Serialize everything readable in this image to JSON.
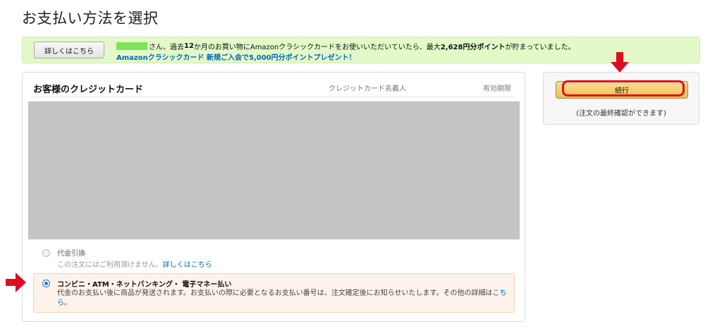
{
  "page": {
    "title": "お支払い方法を選択"
  },
  "promo": {
    "button_label": "詳しくはこちら",
    "line1_prefix": "さん、過去",
    "line1_months": "12",
    "line1_mid": "か月のお買い物にAmazonクラシックカードをお使いいただいていたら、最大",
    "line1_points": "2,628円分ポイント",
    "line1_suffix": "が貯まっていました。",
    "line2": "Amazonクラシックカード 新規ご入会で5,000円分ポイントプレゼント！"
  },
  "cards": {
    "title": "お客様のクレジットカード",
    "col_holder": "クレジットカード名義人",
    "col_expiry": "有効期限"
  },
  "options": {
    "cod": {
      "title": "代金引換",
      "desc": "この注文にはご利用頂けません。",
      "link": "詳しくはこちら",
      "selected": false,
      "enabled": false
    },
    "convenience": {
      "title": "コンビニ・ATM・ネットバンキング・ 電子マネー払い",
      "desc": "代金のお支払い後に商品が発送されます。お支払いの際に必要となるお支払い番号は、注文確定後にお知らせいたします。その他の詳細は",
      "link": "こちら",
      "desc_end": "。",
      "selected": true
    }
  },
  "sidebar": {
    "continue_label": "続行",
    "note": "(注文の最終確認ができます)"
  },
  "colors": {
    "promo_bg": "#e3f9c8",
    "link": "#0066c0",
    "button": "#f0c14b",
    "highlight_red": "#e00d22",
    "selected_bg": "#fdf3ea"
  }
}
